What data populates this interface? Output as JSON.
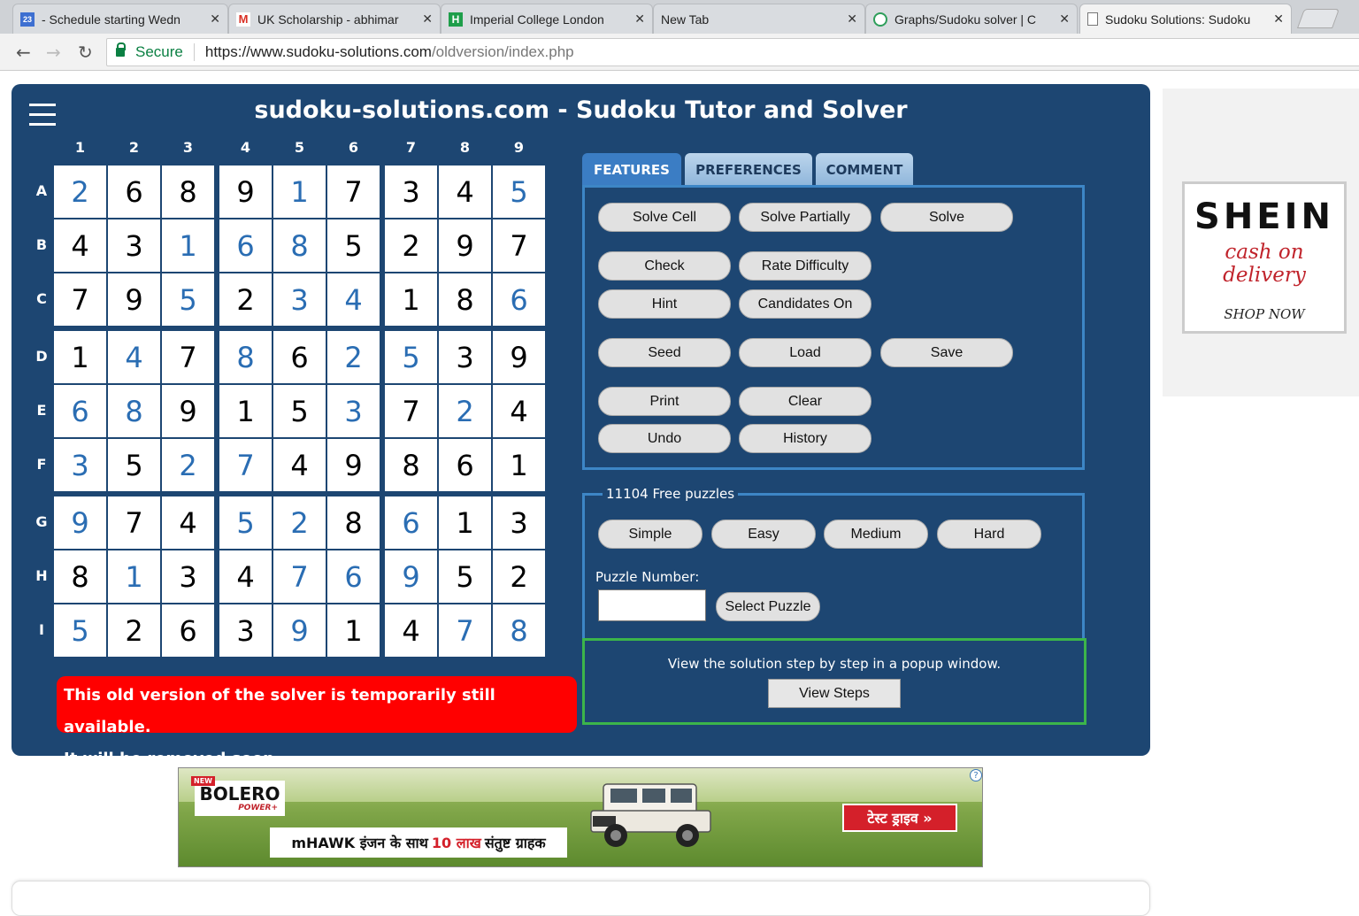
{
  "browser": {
    "tabs": [
      {
        "title": "- Schedule starting Wedn",
        "icon": "calendar-icon",
        "badge": "23"
      },
      {
        "title": "UK Scholarship - abhimar",
        "icon": "gmail-icon",
        "badge": "M"
      },
      {
        "title": "Imperial College London",
        "icon": "site-h-icon",
        "badge": "H"
      },
      {
        "title": "New Tab",
        "icon": "",
        "badge": ""
      },
      {
        "title": "Graphs/Sudoku solver | C",
        "icon": "shield-icon",
        "badge": ""
      },
      {
        "title": "Sudoku Solutions: Sudoku",
        "icon": "page-icon",
        "badge": ""
      }
    ],
    "address": {
      "secure_label": "Secure",
      "url_host": "https://www.sudoku-solutions.com",
      "url_path": "/oldversion/index.php"
    }
  },
  "site": {
    "title": "sudoku-solutions.com - Sudoku Tutor and Solver"
  },
  "grid": {
    "col_labels": [
      "1",
      "2",
      "3",
      "4",
      "5",
      "6",
      "7",
      "8",
      "9"
    ],
    "row_labels": [
      "A",
      "B",
      "C",
      "D",
      "E",
      "F",
      "G",
      "H",
      "I"
    ],
    "values": [
      [
        2,
        6,
        8,
        9,
        1,
        7,
        3,
        4,
        5
      ],
      [
        4,
        3,
        1,
        6,
        8,
        5,
        2,
        9,
        7
      ],
      [
        7,
        9,
        5,
        2,
        3,
        4,
        1,
        8,
        6
      ],
      [
        1,
        4,
        7,
        8,
        6,
        2,
        5,
        3,
        9
      ],
      [
        6,
        8,
        9,
        1,
        5,
        3,
        7,
        2,
        4
      ],
      [
        3,
        5,
        2,
        7,
        4,
        9,
        8,
        6,
        1
      ],
      [
        9,
        7,
        4,
        5,
        2,
        8,
        6,
        1,
        3
      ],
      [
        8,
        1,
        3,
        4,
        7,
        6,
        9,
        5,
        2
      ],
      [
        5,
        2,
        6,
        3,
        9,
        1,
        4,
        7,
        8
      ]
    ],
    "solved_mask": [
      [
        1,
        0,
        0,
        0,
        1,
        0,
        0,
        0,
        1
      ],
      [
        0,
        0,
        1,
        1,
        1,
        0,
        0,
        0,
        0
      ],
      [
        0,
        0,
        1,
        0,
        1,
        1,
        0,
        0,
        1
      ],
      [
        0,
        1,
        0,
        1,
        0,
        1,
        1,
        0,
        0
      ],
      [
        1,
        1,
        0,
        0,
        0,
        1,
        0,
        1,
        0
      ],
      [
        1,
        0,
        1,
        1,
        0,
        0,
        0,
        0,
        0
      ],
      [
        1,
        0,
        0,
        1,
        1,
        0,
        1,
        0,
        0
      ],
      [
        0,
        1,
        0,
        0,
        1,
        1,
        1,
        0,
        0
      ],
      [
        1,
        0,
        0,
        0,
        1,
        0,
        0,
        1,
        1
      ]
    ],
    "given_color": "#000000",
    "solved_color": "#2a6db3"
  },
  "notice": {
    "line1": "This old version of the solver is temporarily still available.",
    "line2": "It will be removed soon."
  },
  "panel_tabs": [
    "FEATURES",
    "PREFERENCES",
    "COMMENT"
  ],
  "features": {
    "solve_cell": "Solve Cell",
    "solve_partially": "Solve Partially",
    "solve": "Solve",
    "check": "Check",
    "rate_difficulty": "Rate Difficulty",
    "hint": "Hint",
    "candidates_on": "Candidates On",
    "seed": "Seed",
    "load": "Load",
    "save": "Save",
    "print": "Print",
    "clear": "Clear",
    "undo": "Undo",
    "history": "History"
  },
  "puzzles": {
    "legend": "11104 Free puzzles",
    "simple": "Simple",
    "easy": "Easy",
    "medium": "Medium",
    "hard": "Hard",
    "number_label": "Puzzle Number:",
    "number_value": "",
    "select_button": "Select Puzzle"
  },
  "steps": {
    "text": "View the solution step by step in a popup window.",
    "button": "View Steps"
  },
  "side_ad": {
    "brand": "SHEIN",
    "tagline": "cash on delivery",
    "cta": "SHOP NOW"
  },
  "bottom_ad": {
    "new_tag": "NEW",
    "brand": "BOLERO",
    "brand_sub": "POWER+",
    "strip_pre": "mHAWK इंजन के साथ",
    "strip_red": "10 लाख",
    "strip_post": "संतुष्ट ग्राहक",
    "cta": "टेस्ट ड्राइव »",
    "info": "?"
  },
  "colors": {
    "panel_bg": "#1d4672",
    "notice_bg": "#ff0000",
    "active_tab": "#3b7dc4",
    "steps_border": "#3cb54a"
  }
}
